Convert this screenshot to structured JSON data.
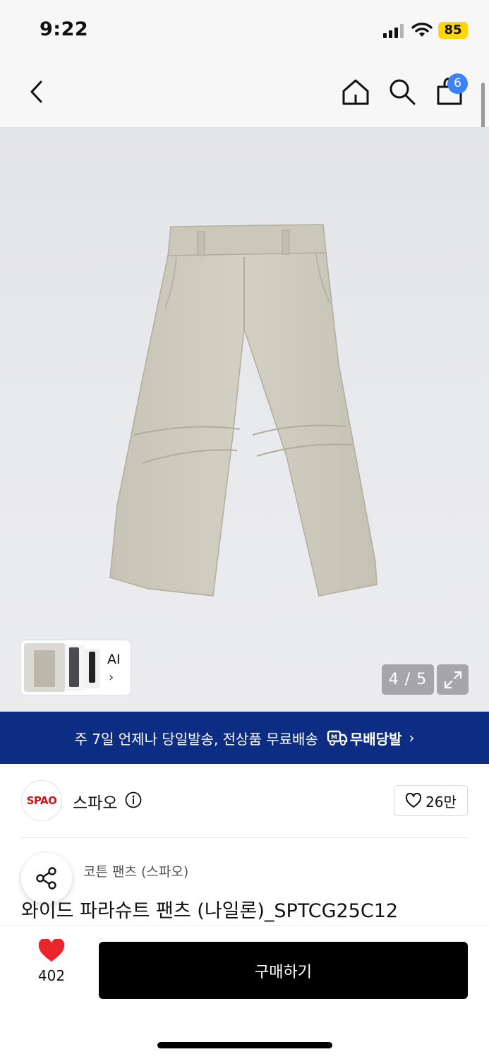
{
  "status_bar": {
    "time": "9:22",
    "battery": "85",
    "battery_color": "#ffd60a"
  },
  "nav": {
    "back_icon": "chevron-left-icon",
    "home_icon": "home-icon",
    "search_icon": "search-icon",
    "cart_icon": "shopping-bag-icon",
    "cart_badge": "6"
  },
  "gallery": {
    "counter": "4 / 5",
    "ai_label": "AI",
    "ai_chevron": "›",
    "expand_icon": "expand-icon",
    "product_color": "#cfcbbf"
  },
  "banner": {
    "text": "주 7일 언제나 당일발송, 전상품 무료배송",
    "logo_text": "무배당발",
    "chevron": "›",
    "bg_color": "#0c2d83"
  },
  "brand": {
    "logo_text": "SPAO",
    "name": "스파오",
    "like_count": "26만"
  },
  "product": {
    "category": "코튼 팬츠 (스파오)",
    "title": "와이드 파라슈트 팬츠 (나일론)_SPTCG25C12"
  },
  "bottom_bar": {
    "like_count": "402",
    "buy_label": "구매하기",
    "heart_color": "#e8262b"
  }
}
